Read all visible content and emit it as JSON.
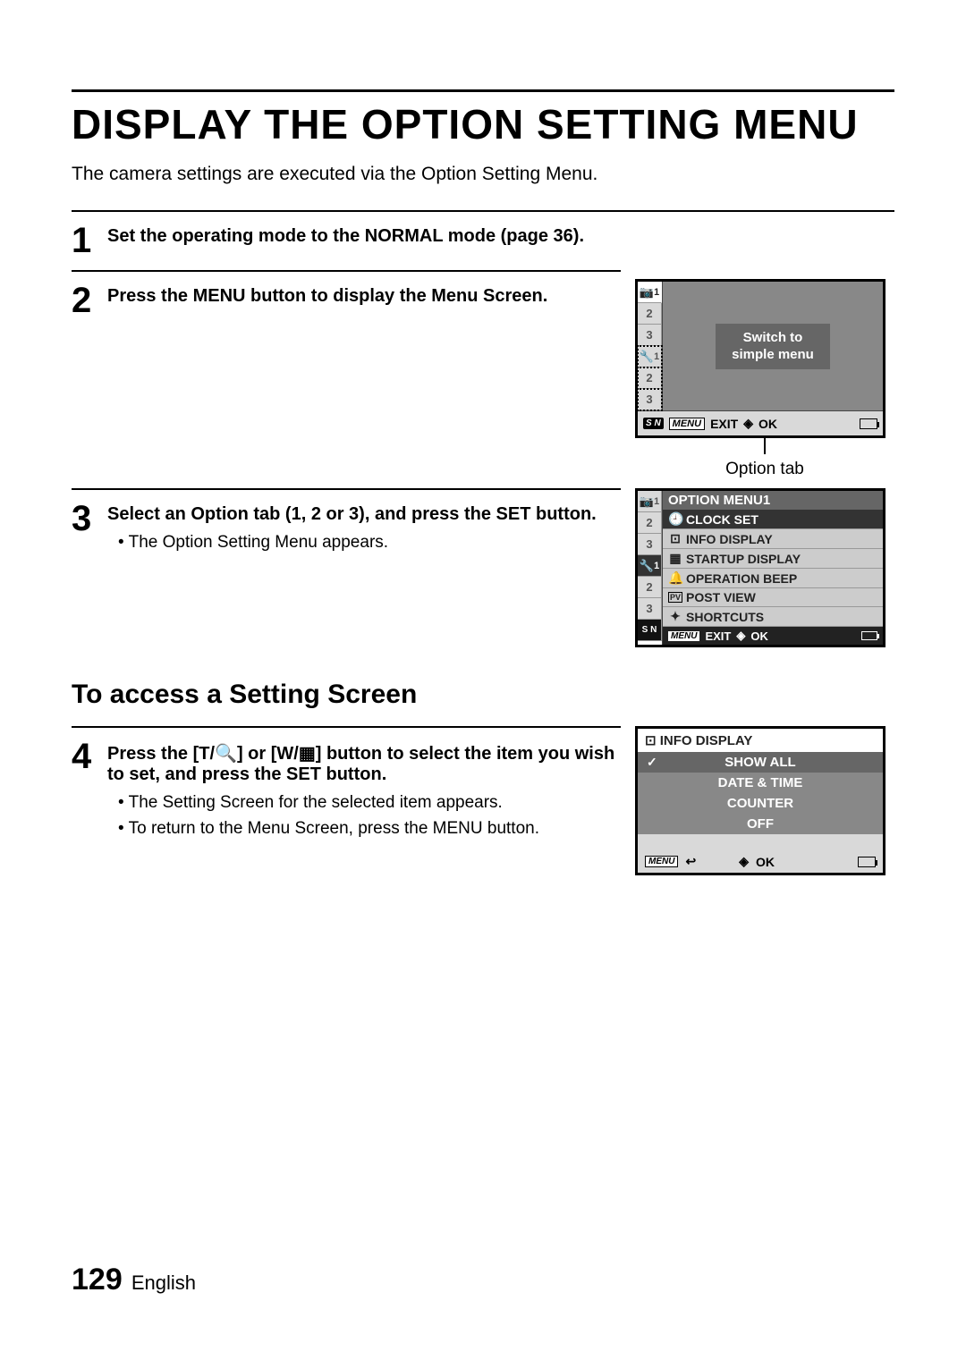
{
  "title": "DISPLAY THE OPTION SETTING MENU",
  "intro": "The camera settings are executed via the Option Setting Menu.",
  "steps": {
    "s1": {
      "num": "1",
      "text": "Set the operating mode to the NORMAL mode (page 36)."
    },
    "s2": {
      "num": "2",
      "text": "Press the MENU button to display the Menu Screen."
    },
    "s3": {
      "num": "3",
      "text": "Select an Option tab (1, 2 or 3), and press the SET button.",
      "bullet": "The Option Setting Menu appears."
    },
    "s4": {
      "num": "4",
      "text_a": "Press the [T/",
      "text_b": "] or [W/",
      "text_c": "] button to select the item you wish to set, and press the SET button.",
      "bullets": [
        "The Setting Screen for the selected item appears.",
        "To return to the Menu Screen, press the MENU button."
      ]
    }
  },
  "subhead": "To access a Setting Screen",
  "lcd1": {
    "tabs_top": [
      "1",
      "2",
      "3"
    ],
    "tabs_bottom": [
      "1",
      "2",
      "3"
    ],
    "switch_line1": "Switch to",
    "switch_line2": "simple menu",
    "footer_exit": "EXIT",
    "footer_ok": "OK",
    "menu_label": "MENU",
    "sn_label": "S N",
    "callout": "Option tab"
  },
  "lcd2": {
    "title": "OPTION MENU1",
    "items": [
      {
        "icon": "🕘",
        "label": "CLOCK SET",
        "selected": true
      },
      {
        "icon": "⊡",
        "label": "INFO DISPLAY",
        "selected": false
      },
      {
        "icon": "▦",
        "label": "STARTUP DISPLAY",
        "selected": false
      },
      {
        "icon": "🔔",
        "label": "OPERATION BEEP",
        "selected": false
      },
      {
        "icon": "PV",
        "label": "POST VIEW",
        "selected": false
      },
      {
        "icon": "✦",
        "label": "SHORTCUTS",
        "selected": false
      }
    ],
    "tabs_top": [
      "1",
      "2",
      "3"
    ],
    "tabs_bottom": [
      "1",
      "2",
      "3"
    ],
    "footer_exit": "EXIT",
    "footer_ok": "OK",
    "menu_label": "MENU",
    "sn_label": "S N"
  },
  "lcd3": {
    "title_icon": "⊡",
    "title": "INFO DISPLAY",
    "items": [
      {
        "label": "SHOW ALL",
        "selected": true,
        "checked": true
      },
      {
        "label": "DATE & TIME",
        "selected": false,
        "checked": false
      },
      {
        "label": "COUNTER",
        "selected": false,
        "checked": false
      },
      {
        "label": "OFF",
        "selected": false,
        "checked": false
      }
    ],
    "menu_label": "MENU",
    "return_icon": "↩",
    "footer_ok": "OK"
  },
  "footer": {
    "page": "129",
    "lang": "English"
  }
}
